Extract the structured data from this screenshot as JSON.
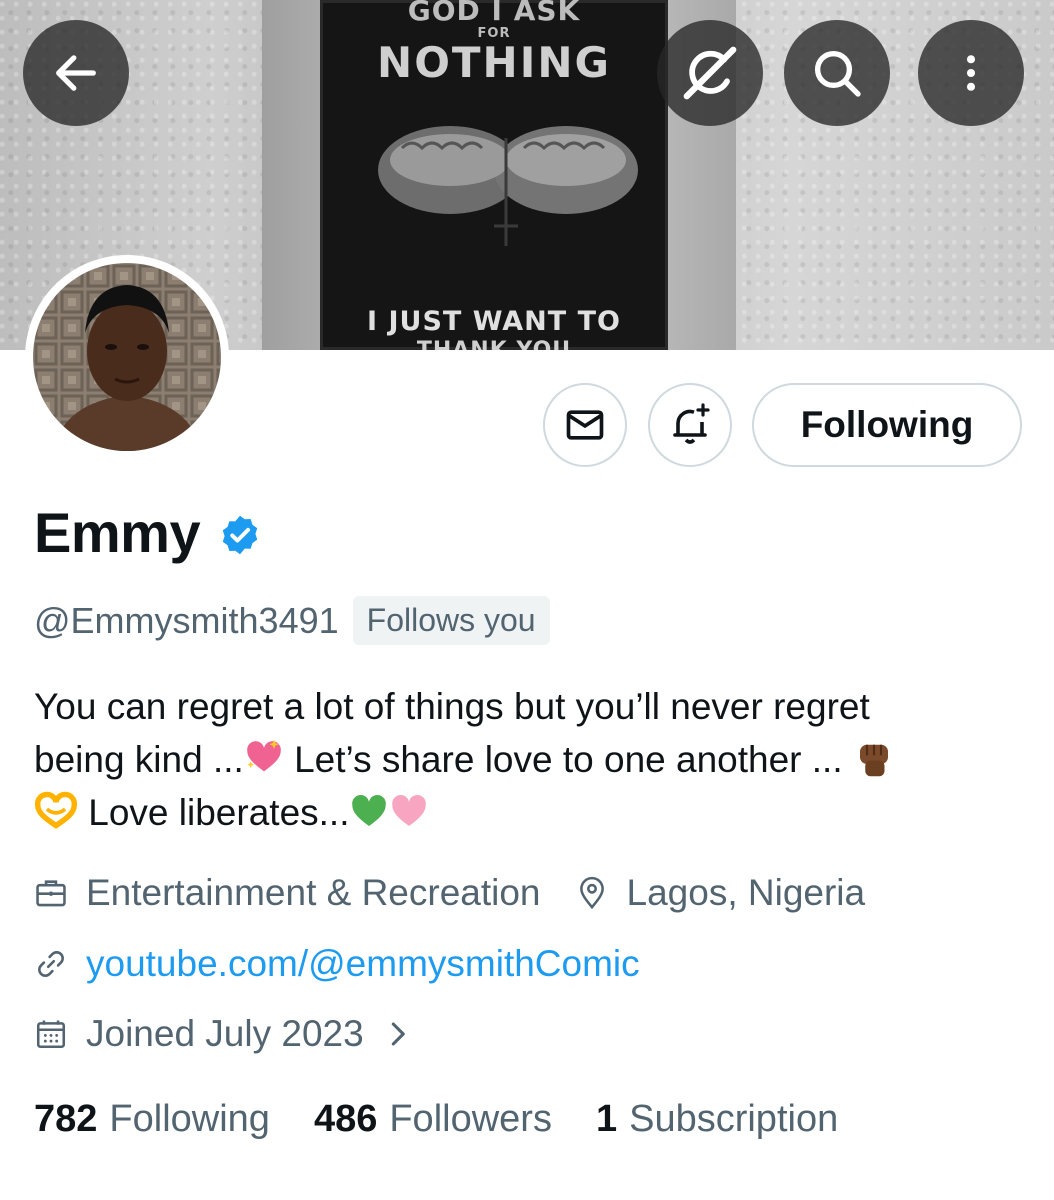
{
  "header": {
    "back_icon": "arrow-left-icon",
    "grok_icon": "grok-slash-icon",
    "search_icon": "search-icon",
    "more_icon": "more-vertical-icon"
  },
  "banner": {
    "poster_lines": [
      "GOD I ASK",
      "FOR",
      "NOTHING",
      "I JUST WANT TO",
      "THANK YOU"
    ]
  },
  "actions": {
    "message_icon": "envelope-icon",
    "notify_icon": "bell-plus-icon",
    "follow_label": "Following"
  },
  "profile": {
    "name": "Emmy",
    "verified": true,
    "handle": "@Emmysmith3491",
    "follows_you": "Follows you",
    "bio": {
      "line1": "You can regret a lot of things but you’ll never regret",
      "line2a": "being kind ...",
      "line2b": " Let’s share love to one another ... ",
      "line3": " Love liberates..."
    },
    "category": "Entertainment & Recreation",
    "location": "Lagos, Nigeria",
    "website": "youtube.com/@emmysmithComic",
    "joined": "Joined July 2023"
  },
  "stats": {
    "following_count": "782",
    "following_label": "Following",
    "followers_count": "486",
    "followers_label": "Followers",
    "subscriptions_count": "1",
    "subscriptions_label": "Subscription"
  },
  "colors": {
    "accent": "#1d9bf0",
    "secondary_text": "#536471",
    "border": "#cfd9de"
  }
}
